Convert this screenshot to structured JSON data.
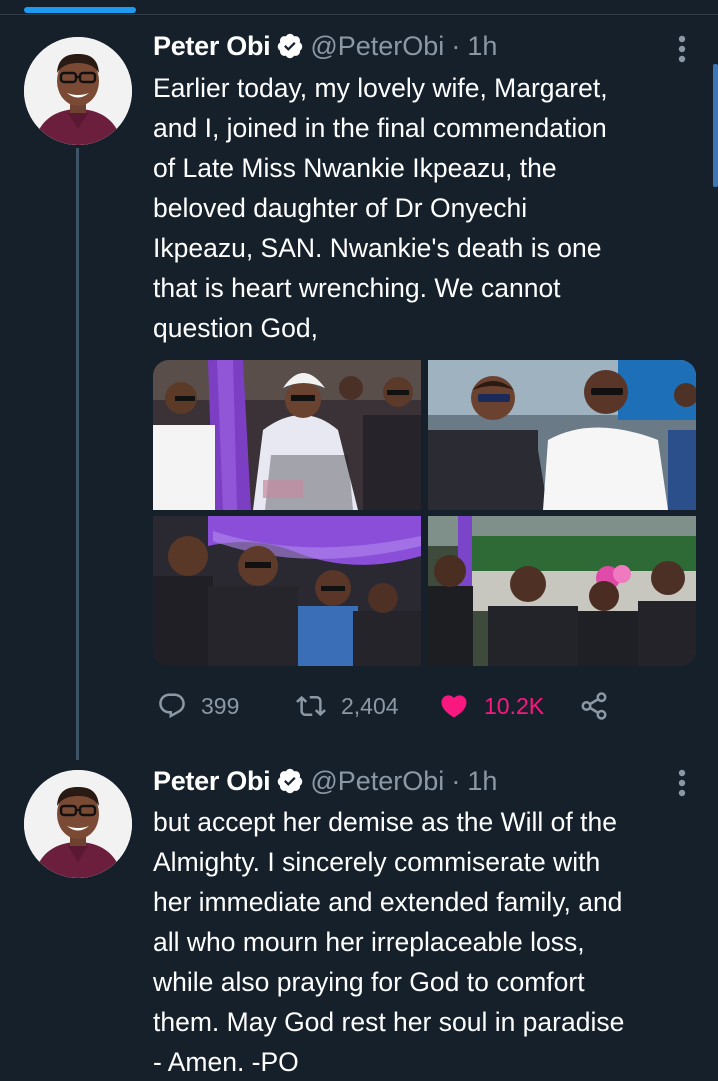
{
  "colors": {
    "background": "#15202b",
    "accent_blue": "#1d9bf0",
    "muted_text": "#8b98a5",
    "like_pink": "#f91880",
    "thread_line": "#3d5466"
  },
  "tweets": [
    {
      "author_name": "Peter Obi",
      "handle": "@PeterObi",
      "separator": "·",
      "time": "1h",
      "text": "Earlier today, my lovely wife, Margaret,\nand I, joined in the final commendation\nof Late Miss Nwankie Ikpeazu, the\nbeloved daughter of Dr Onyechi\nIkpeazu, SAN. Nwankie's death is one\nthat is heart wrenching. We cannot\nquestion God,",
      "media_count": 4,
      "actions": {
        "replies": "399",
        "retweets": "2,404",
        "likes": "10.2K",
        "liked": true
      },
      "icons": [
        "verified-icon",
        "more-icon",
        "reply-icon",
        "retweet-icon",
        "like-icon",
        "share-icon"
      ]
    },
    {
      "author_name": "Peter Obi",
      "handle": "@PeterObi",
      "separator": "·",
      "time": "1h",
      "text": "but accept her demise as the Will of the\nAlmighty. I sincerely commiserate with\nher immediate and extended family, and\nall who mourn her irreplaceable loss,\nwhile also praying for God to comfort\nthem. May God rest her soul in paradise\n- Amen. -PO",
      "icons": [
        "verified-icon",
        "more-icon"
      ]
    }
  ]
}
